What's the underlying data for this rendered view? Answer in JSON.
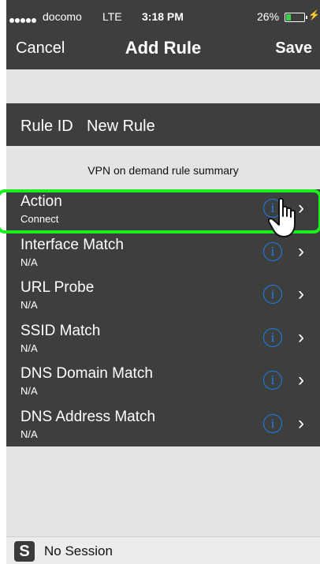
{
  "status": {
    "carrier": "docomo",
    "network": "LTE",
    "time": "3:18 PM",
    "battery": "26%",
    "battery_level": 0.26
  },
  "nav": {
    "cancel_label": "Cancel",
    "title": "Add Rule",
    "save_label": "Save"
  },
  "rule_id": {
    "label": "Rule ID",
    "value": "New Rule"
  },
  "summary_header": "VPN on demand rule summary",
  "rules": [
    {
      "title": "Action",
      "value": "Connect"
    },
    {
      "title": "Interface Match",
      "value": "N/A"
    },
    {
      "title": "URL Probe",
      "value": "N/A"
    },
    {
      "title": "SSID Match",
      "value": "N/A"
    },
    {
      "title": "DNS Domain Match",
      "value": "N/A"
    },
    {
      "title": "DNS Address Match",
      "value": "N/A"
    }
  ],
  "session": {
    "label": "No Session",
    "icon_glyph": "S"
  },
  "colors": {
    "bar": "#3d3f3f",
    "info_blue": "#1f7ee8",
    "highlight_green": "#19f01e"
  },
  "icons": {
    "info": "info-icon",
    "chevron": "chevron-right-icon",
    "pointer": "hand-pointer-icon"
  }
}
